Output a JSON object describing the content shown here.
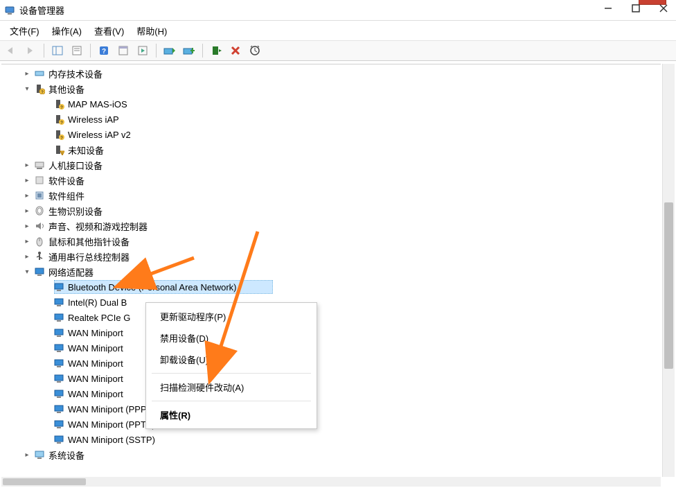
{
  "window": {
    "title": "设备管理器"
  },
  "menu": {
    "file": "文件(F)",
    "action": "操作(A)",
    "view": "查看(V)",
    "help": "帮助(H)"
  },
  "tree": {
    "memory_tech": "内存技术设备",
    "other_devices": "其他设备",
    "map_mas_ios": "MAP MAS-iOS",
    "wireless_iap": "Wireless iAP",
    "wireless_iap_v2": "Wireless iAP v2",
    "unknown_device": "未知设备",
    "hid": "人机接口设备",
    "software_devices": "软件设备",
    "software_components": "软件组件",
    "biometric": "生物识别设备",
    "sound": "声音、视频和游戏控制器",
    "mouse": "鼠标和其他指针设备",
    "usb": "通用串行总线控制器",
    "network_adapters": "网络适配器",
    "bt_pan": "Bluetooth Device (Personal Area Network)",
    "intel_dual": "Intel(R) Dual B",
    "realtek_pcie": "Realtek PCIe G",
    "wan_miniport_1": "WAN Miniport",
    "wan_miniport_2": "WAN Miniport",
    "wan_miniport_3": "WAN Miniport",
    "wan_miniport_4": "WAN Miniport",
    "wan_miniport_5": "WAN Miniport",
    "wan_miniport_pppoe": "WAN Miniport (PPPOE)",
    "wan_miniport_pptp": "WAN Miniport (PPTP)",
    "wan_miniport_sstp": "WAN Miniport (SSTP)",
    "system_devices": "系统设备"
  },
  "context_menu": {
    "update_driver": "更新驱动程序(P)",
    "disable_device": "禁用设备(D)",
    "uninstall_device": "卸载设备(U)",
    "scan_hardware": "扫描检测硬件改动(A)",
    "properties": "属性(R)"
  }
}
